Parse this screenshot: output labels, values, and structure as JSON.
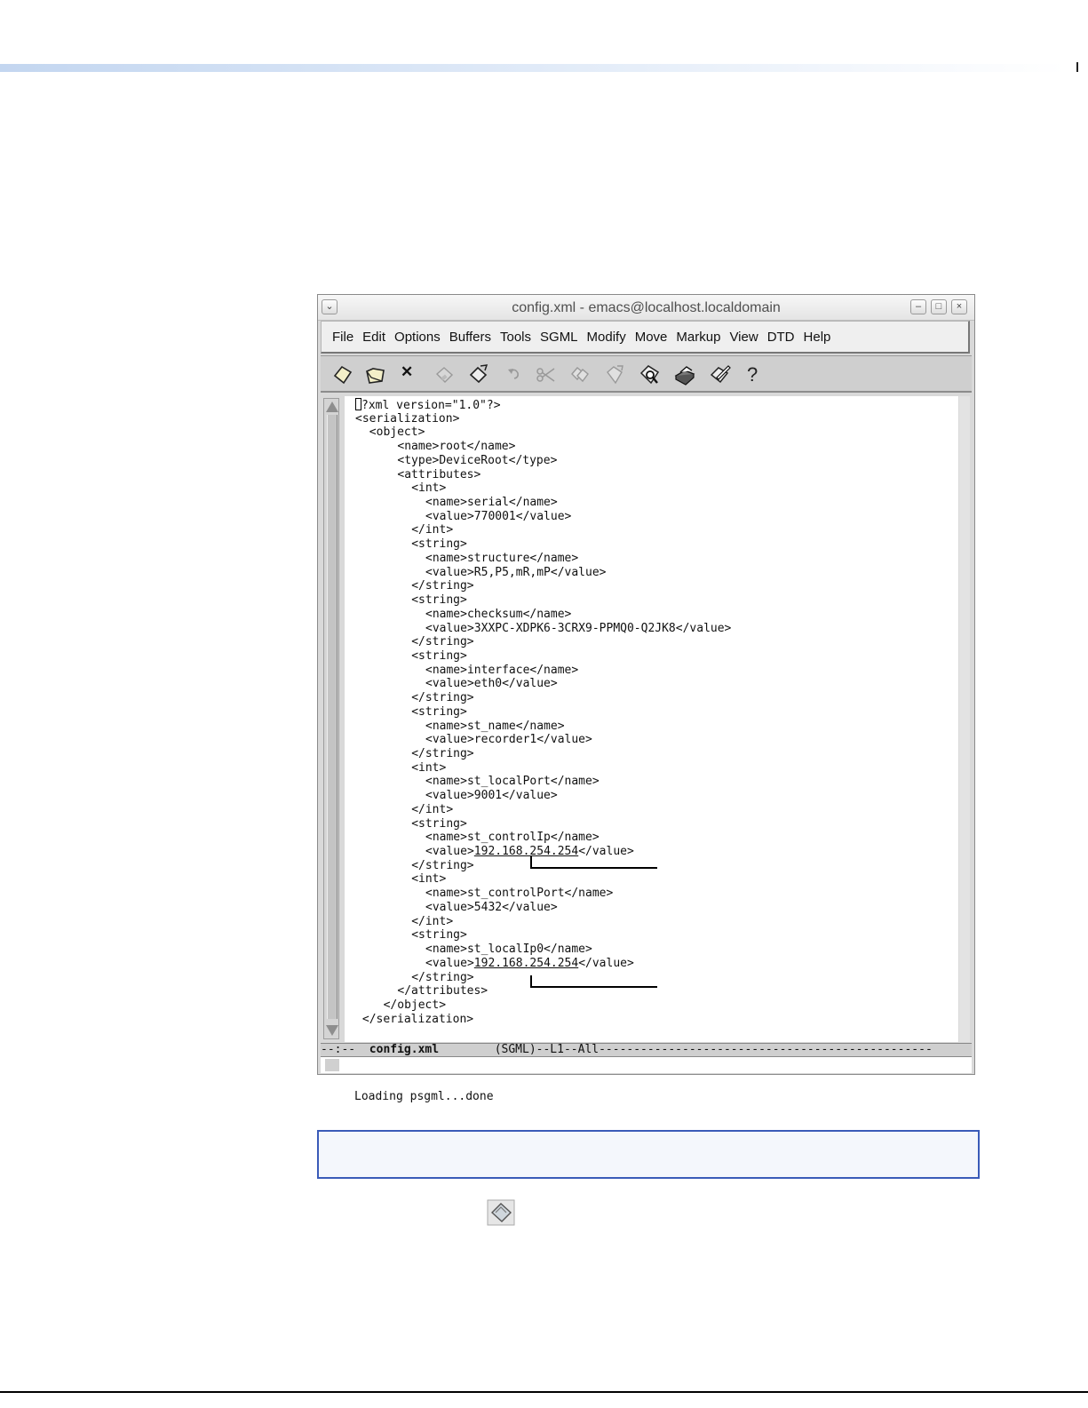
{
  "window": {
    "title": "config.xml - emacs@localhost.localdomain",
    "controls": {
      "menu": "⌄",
      "minimize": "–",
      "maximize": "□",
      "close": "×"
    }
  },
  "menubar": {
    "items": [
      "File",
      "Edit",
      "Options",
      "Buffers",
      "Tools",
      "SGML",
      "Modify",
      "Move",
      "Markup",
      "View",
      "DTD",
      "Help"
    ]
  },
  "toolbar": {
    "icons": [
      "new-file-icon",
      "open-folder-icon",
      "close-buffer-icon",
      "save-icon",
      "save-as-icon",
      "undo-icon",
      "cut-icon",
      "copy-icon",
      "paste-icon",
      "search-icon",
      "print-icon",
      "edit-icon",
      "help-icon"
    ],
    "close_glyph": "✕",
    "help_glyph": "?"
  },
  "editor": {
    "lines": [
      {
        "indent": 0,
        "text": "?xml version=\"1.0\"?>",
        "cursor": true
      },
      {
        "indent": 0,
        "text": "<serialization>"
      },
      {
        "indent": 2,
        "text": "<object>"
      },
      {
        "indent": 6,
        "text": "<name>root</name>"
      },
      {
        "indent": 6,
        "text": "<type>DeviceRoot</type>"
      },
      {
        "indent": 6,
        "text": "<attributes>"
      },
      {
        "indent": 8,
        "text": "<int>"
      },
      {
        "indent": 10,
        "text": "<name>serial</name>"
      },
      {
        "indent": 10,
        "text": "<value>770001</value>"
      },
      {
        "indent": 8,
        "text": "</int>"
      },
      {
        "indent": 8,
        "text": "<string>"
      },
      {
        "indent": 10,
        "text": "<name>structure</name>"
      },
      {
        "indent": 10,
        "text": "<value>R5,P5,mR,mP</value>"
      },
      {
        "indent": 8,
        "text": "</string>"
      },
      {
        "indent": 8,
        "text": "<string>"
      },
      {
        "indent": 10,
        "text": "<name>checksum</name>"
      },
      {
        "indent": 10,
        "text": "<value>3XXPC-XDPK6-3CRX9-PPMQ0-Q2JK8</value>"
      },
      {
        "indent": 8,
        "text": "</string>"
      },
      {
        "indent": 8,
        "text": "<string>"
      },
      {
        "indent": 10,
        "text": "<name>interface</name>"
      },
      {
        "indent": 10,
        "text": "<value>eth0</value>"
      },
      {
        "indent": 8,
        "text": "</string>"
      },
      {
        "indent": 8,
        "text": "<string>"
      },
      {
        "indent": 10,
        "text": "<name>st_name</name>"
      },
      {
        "indent": 10,
        "text": "<value>recorder1</value>"
      },
      {
        "indent": 8,
        "text": "</string>"
      },
      {
        "indent": 8,
        "text": "<int>"
      },
      {
        "indent": 10,
        "text": "<name>st_localPort</name>"
      },
      {
        "indent": 10,
        "text": "<value>9001</value>"
      },
      {
        "indent": 8,
        "text": "</int>"
      },
      {
        "indent": 8,
        "text": "<string>"
      },
      {
        "indent": 10,
        "text": "<name>st_controlIp</name>"
      },
      {
        "indent": 10,
        "pre": "<value>",
        "ul": "192.168.254.254",
        "post": "</value>"
      },
      {
        "indent": 8,
        "text": "</string>"
      },
      {
        "indent": 8,
        "text": "<int>"
      },
      {
        "indent": 10,
        "text": "<name>st_controlPort</name>"
      },
      {
        "indent": 10,
        "text": "<value>5432</value>"
      },
      {
        "indent": 8,
        "text": "</int>"
      },
      {
        "indent": 8,
        "text": "<string>"
      },
      {
        "indent": 10,
        "text": "<name>st_localIp0</name>"
      },
      {
        "indent": 10,
        "pre": "<value>",
        "ul": "192.168.254.254",
        "post": "</value>"
      },
      {
        "indent": 8,
        "text": "</string>"
      },
      {
        "indent": 6,
        "text": "</attributes>"
      },
      {
        "indent": 4,
        "text": "</object>"
      },
      {
        "indent": 1,
        "text": "</serialization>"
      }
    ]
  },
  "modeline": {
    "prefix": "--:--  ",
    "buffer": "config.xml",
    "suffix": "        (SGML)--L1--All------------------------------------------------"
  },
  "echo_area": {
    "text": "Loading psgml...done"
  }
}
